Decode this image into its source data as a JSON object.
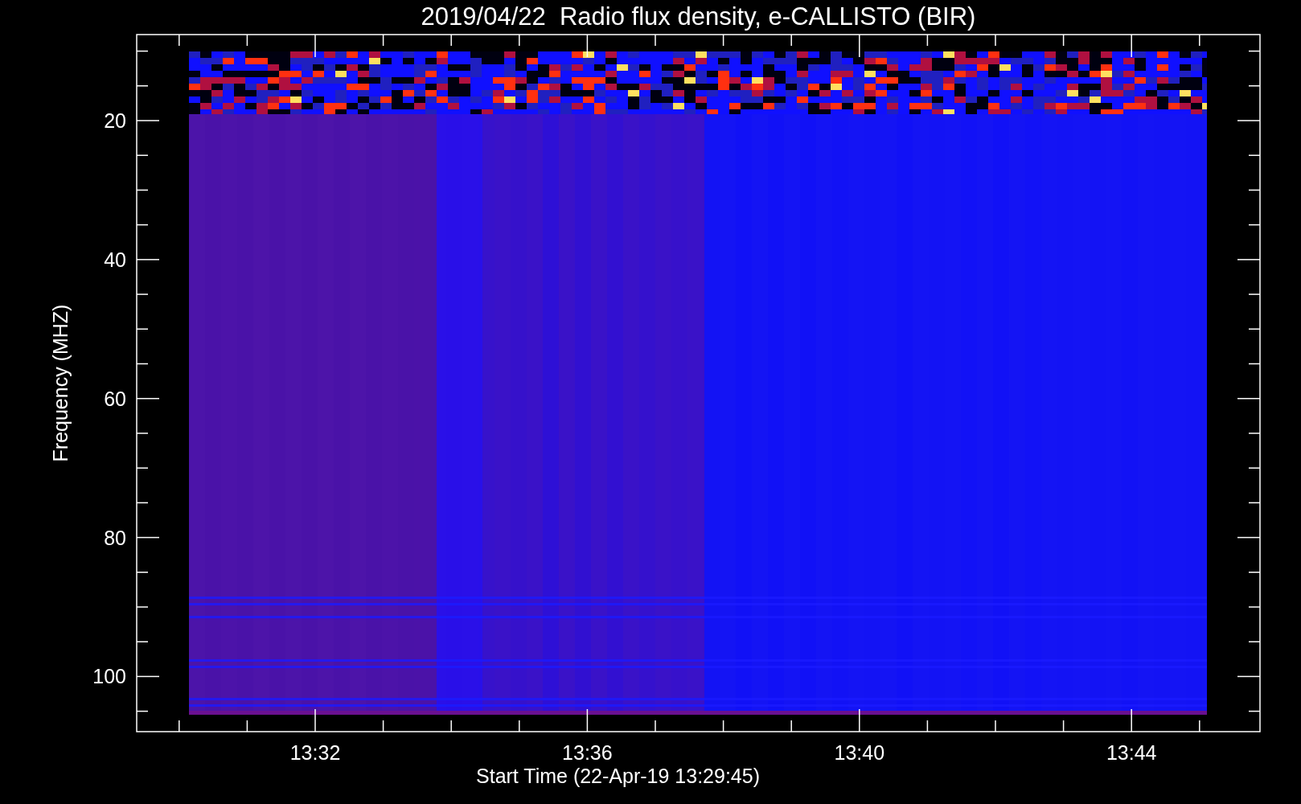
{
  "title": "2019/04/22  Radio flux density, e-CALLISTO (BIR)",
  "y_axis": {
    "label": "Frequency (MHZ)",
    "ticks": [
      "20",
      "40",
      "60",
      "80",
      "100"
    ]
  },
  "x_axis": {
    "label": "Start Time (22-Apr-19 13:29:45)",
    "ticks": [
      "13:32",
      "13:36",
      "13:40",
      "13:44"
    ]
  }
}
